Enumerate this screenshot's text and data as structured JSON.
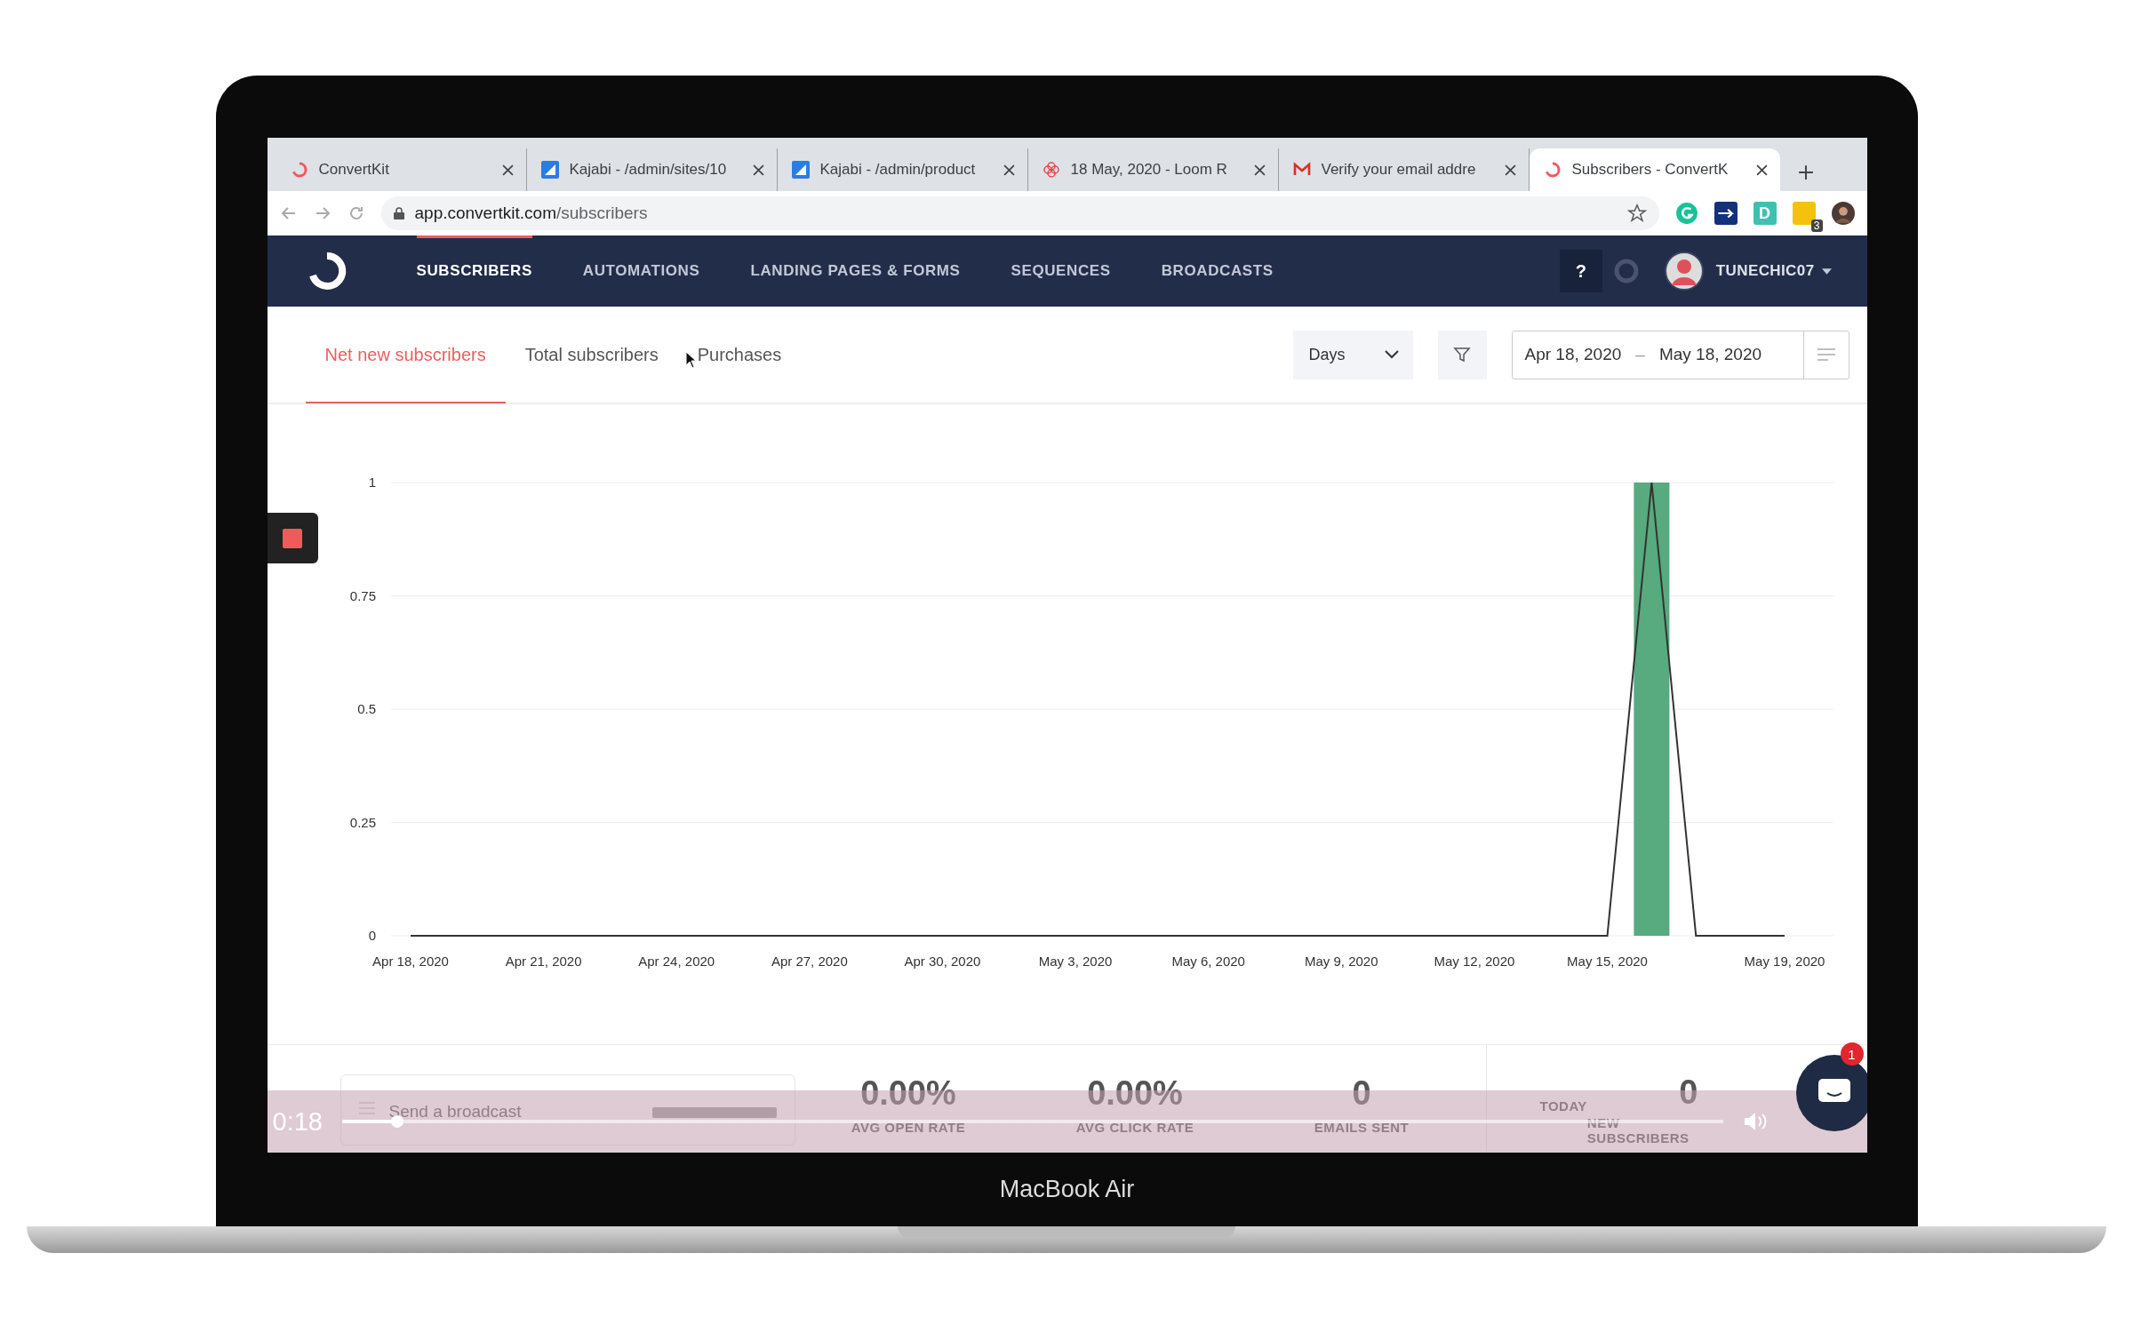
{
  "device": {
    "label": "MacBook Air"
  },
  "browser": {
    "tabs": [
      {
        "title": "ConvertKit",
        "kind": "convertkit",
        "selected": false
      },
      {
        "title": "Kajabi - /admin/sites/10",
        "kind": "kajabi",
        "selected": false
      },
      {
        "title": "Kajabi - /admin/product",
        "kind": "kajabi",
        "selected": false
      },
      {
        "title": "18 May, 2020 - Loom R",
        "kind": "loom",
        "selected": false
      },
      {
        "title": "Verify your email addre",
        "kind": "gmail",
        "selected": false
      },
      {
        "title": "Subscribers - ConvertK",
        "kind": "convertkit",
        "selected": true
      }
    ],
    "url_domain": "app.convertkit.com",
    "url_path": "/subscribers",
    "extensions": [
      {
        "kind": "grammarly"
      },
      {
        "kind": "plane"
      },
      {
        "kind": "letter",
        "text": "D"
      },
      {
        "kind": "notes",
        "badge": "3"
      },
      {
        "kind": "profile"
      }
    ]
  },
  "nav": {
    "items": [
      {
        "label": "SUBSCRIBERS",
        "selected": true
      },
      {
        "label": "AUTOMATIONS",
        "selected": false
      },
      {
        "label": "LANDING PAGES & FORMS",
        "selected": false
      },
      {
        "label": "SEQUENCES",
        "selected": false
      },
      {
        "label": "BROADCASTS",
        "selected": false
      }
    ],
    "help": "?",
    "user": "TUNECHIC07"
  },
  "report_tabs": [
    {
      "label": "Net new subscribers",
      "selected": true
    },
    {
      "label": "Total subscribers",
      "selected": false
    },
    {
      "label": "Purchases",
      "selected": false
    }
  ],
  "interval": "Days",
  "date_from": "Apr 18, 2020",
  "date_separator": "–",
  "date_to": "May 18, 2020",
  "chart": {
    "chart_data": {
      "type": "bar",
      "categories": [
        "Apr 18, 2020",
        null,
        null,
        "Apr 21, 2020",
        null,
        null,
        "Apr 24, 2020",
        null,
        null,
        "Apr 27, 2020",
        null,
        null,
        "Apr 30, 2020",
        null,
        null,
        "May 3, 2020",
        null,
        null,
        "May 6, 2020",
        null,
        null,
        "May 9, 2020",
        null,
        null,
        "May 12, 2020",
        null,
        null,
        "May 15, 2020",
        null,
        null,
        null,
        "May 19, 2020"
      ],
      "grid": true,
      "series": [
        {
          "color": "#57ab7e",
          "values": [
            0,
            0,
            0,
            0,
            0,
            0,
            0,
            0,
            0,
            0,
            0,
            0,
            0,
            0,
            0,
            0,
            0,
            0,
            0,
            0,
            0,
            0,
            0,
            0,
            0,
            0,
            0,
            0,
            1,
            0,
            0,
            0
          ]
        }
      ],
      "ylim": [
        0,
        1
      ],
      "yticks": [
        0,
        0.25,
        0.5,
        0.75,
        1
      ]
    }
  },
  "stats": {
    "broadcast_placeholder": "Send a broadcast",
    "items": [
      {
        "value": "0.00%",
        "label": "AVG OPEN RATE"
      },
      {
        "value": "0.00%",
        "label": "AVG CLICK RATE"
      },
      {
        "value": "0",
        "label": "EMAILS SENT"
      }
    ],
    "today": {
      "label": "TODAY",
      "value": "0",
      "caption": "NEW SUBSCRIBERS"
    }
  },
  "video": {
    "time": "0:18",
    "level": 0.04
  },
  "chat": {
    "badge": "1"
  }
}
